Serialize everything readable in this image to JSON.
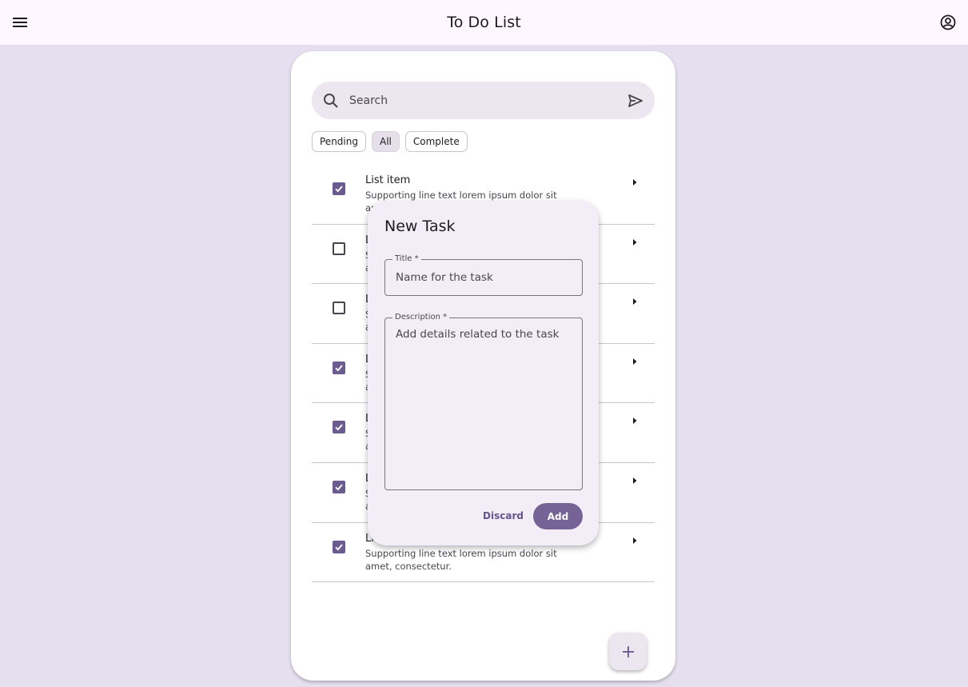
{
  "app_bar": {
    "title": "To Do List",
    "menu_icon": "menu-icon",
    "account_icon": "account-circle-icon"
  },
  "search": {
    "placeholder": "Search",
    "value": ""
  },
  "filters": [
    {
      "label": "Pending",
      "selected": false
    },
    {
      "label": "All",
      "selected": true
    },
    {
      "label": "Complete",
      "selected": false
    }
  ],
  "tasks": [
    {
      "title": "List item",
      "support": "Supporting line text lorem ipsum dolor sit amet, consectetur.",
      "checked": true
    },
    {
      "title": "List item",
      "support": "Supporting line text lorem ipsum dolor sit amet, consectetur.",
      "checked": false
    },
    {
      "title": "List item",
      "support": "Supporting line text lorem ipsum dolor sit amet, consectetur.",
      "checked": false
    },
    {
      "title": "List item",
      "support": "Supporting line text lorem ipsum dolor sit amet, consectetur.",
      "checked": true
    },
    {
      "title": "List item",
      "support": "Supporting line text lorem ipsum dolor sit amet, consectetur.",
      "checked": true
    },
    {
      "title": "List item",
      "support": "Supporting line text lorem ipsum dolor sit amet, consectetur.",
      "checked": true
    },
    {
      "title": "List item",
      "support": "Supporting line text lorem ipsum dolor sit amet, consectetur.",
      "checked": true
    }
  ],
  "fab": {
    "icon": "plus-icon"
  },
  "dialog": {
    "title": "New Task",
    "title_field": {
      "label": "Title *",
      "placeholder": "Name for the task",
      "value": ""
    },
    "description_field": {
      "label": "Description *",
      "placeholder": "Add details related to the task",
      "value": ""
    },
    "discard_label": "Discard",
    "add_label": "Add"
  },
  "colors": {
    "primary": "#65558f",
    "background": "#e6dff0",
    "surface": "#fef7ff",
    "checkbox_checked": "#6b5b8f"
  }
}
